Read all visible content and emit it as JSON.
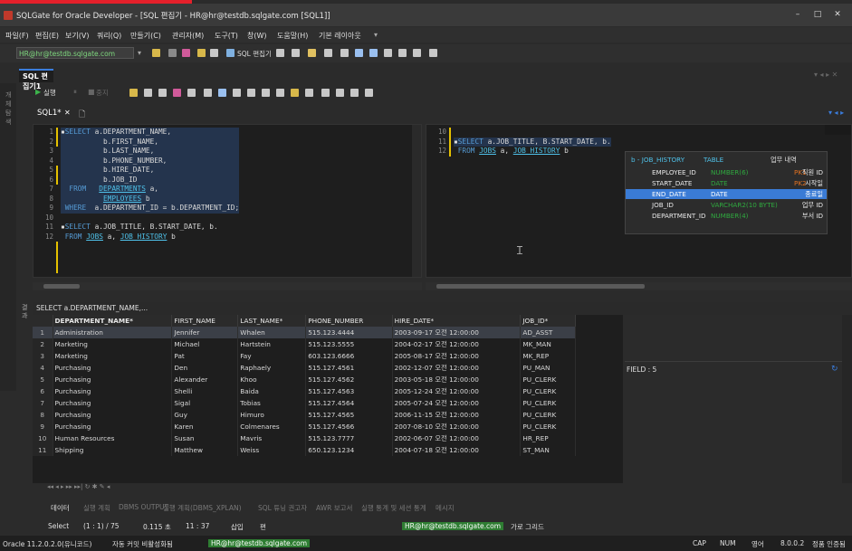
{
  "window": {
    "title": "SQLGate for Oracle Developer - [SQL 편집기 - HR@hr@testdb.sqlgate.com [SQL1]]"
  },
  "menu": [
    "파일(F)",
    "편집(E)",
    "보기(V)",
    "쿼리(Q)",
    "만들기(C)",
    "관리자(M)",
    "도구(T)",
    "창(W)",
    "도움말(H)",
    "기본 레이아웃"
  ],
  "toolbar": {
    "connection": "HR@hr@testdb.sqlgate.com",
    "sql_editor_label": "SQL 편집기"
  },
  "doc_tab": "SQL 편집기1",
  "editor_toolbar": {
    "run": "실행",
    "stop": "중지"
  },
  "sql_tab": "SQL1*",
  "sidebar_label": "개체 탐색",
  "editor_left": {
    "line_numbers": [
      "1",
      "2",
      "3",
      "4",
      "5",
      "6",
      "7",
      "8",
      "9",
      "10",
      "11",
      "12"
    ],
    "lines": [
      [
        "kw:SELECT",
        " a.DEPARTMENT_NAME,"
      ],
      [
        "",
        "          b.FIRST_NAME,"
      ],
      [
        "",
        "          b.LAST_NAME,"
      ],
      [
        "",
        "          b.PHONE_NUMBER,"
      ],
      [
        "",
        "          b.HIRE_DATE,"
      ],
      [
        "",
        "          b.JOB_ID"
      ],
      [
        "kw:  FROM",
        "   ",
        "tbl:DEPARTMENTS",
        " a,"
      ],
      [
        "",
        "          ",
        "tbl:EMPLOYEES",
        " b"
      ],
      [
        "kw: WHERE",
        "  a.DEPARTMENT_ID = b.DEPARTMENT_ID;"
      ],
      [
        ""
      ],
      [
        "kw:SELECT",
        " a.JOB_TITLE, B.START_DATE, b."
      ],
      [
        "kw: FROM",
        " ",
        "tbl:JOBS",
        " a, ",
        "tbl:JOB_HISTORY",
        " b"
      ]
    ]
  },
  "editor_right": {
    "line_numbers": [
      "10",
      "11",
      "12"
    ],
    "lines": [
      [
        ""
      ],
      [
        "kw:SELECT",
        " a.JOB_TITLE, B.START_DATE, b."
      ],
      [
        "kw: FROM",
        " ",
        "tbl:JOBS",
        " a, ",
        "tbl:JOB_HISTORY",
        " b"
      ]
    ]
  },
  "autocomplete": {
    "header": {
      "name": "b - JOB_HISTORY",
      "type": "TABLE",
      "comment": "업무 내역"
    },
    "rows": [
      {
        "name": "EMPLOYEE_ID",
        "type": "NUMBER(6)",
        "key": "PK1",
        "comment": "직원 ID",
        "selected": false
      },
      {
        "name": "START_DATE",
        "type": "DATE",
        "key": "PK2",
        "comment": "시작일",
        "selected": false
      },
      {
        "name": "END_DATE",
        "type": "DATE",
        "key": "",
        "comment": "종료일",
        "selected": true
      },
      {
        "name": "JOB_ID",
        "type": "VARCHAR2(10 BYTE)",
        "key": "",
        "comment": "업무 ID",
        "selected": false
      },
      {
        "name": "DEPARTMENT_ID",
        "type": "NUMBER(4)",
        "key": "",
        "comment": "부서 ID",
        "selected": false
      }
    ]
  },
  "field_count": "FIELD : 5",
  "results": {
    "side_label": "결과",
    "query_label": "SELECT a.DEPARTMENT_NAME,...",
    "columns": [
      "DEPARTMENT_NAME*",
      "FIRST_NAME",
      "LAST_NAME*",
      "PHONE_NUMBER",
      "HIRE_DATE*",
      "JOB_ID*"
    ],
    "rows": [
      [
        "1",
        "Administration",
        "Jennifer",
        "Whalen",
        "515.123.4444",
        "2003-09-17 오전 12:00:00",
        "AD_ASST"
      ],
      [
        "2",
        "Marketing",
        "Michael",
        "Hartstein",
        "515.123.5555",
        "2004-02-17 오전 12:00:00",
        "MK_MAN"
      ],
      [
        "3",
        "Marketing",
        "Pat",
        "Fay",
        "603.123.6666",
        "2005-08-17 오전 12:00:00",
        "MK_REP"
      ],
      [
        "4",
        "Purchasing",
        "Den",
        "Raphaely",
        "515.127.4561",
        "2002-12-07 오전 12:00:00",
        "PU_MAN"
      ],
      [
        "5",
        "Purchasing",
        "Alexander",
        "Khoo",
        "515.127.4562",
        "2003-05-18 오전 12:00:00",
        "PU_CLERK"
      ],
      [
        "6",
        "Purchasing",
        "Shelli",
        "Baida",
        "515.127.4563",
        "2005-12-24 오전 12:00:00",
        "PU_CLERK"
      ],
      [
        "7",
        "Purchasing",
        "Sigal",
        "Tobias",
        "515.127.4564",
        "2005-07-24 오전 12:00:00",
        "PU_CLERK"
      ],
      [
        "8",
        "Purchasing",
        "Guy",
        "Himuro",
        "515.127.4565",
        "2006-11-15 오전 12:00:00",
        "PU_CLERK"
      ],
      [
        "9",
        "Purchasing",
        "Karen",
        "Colmenares",
        "515.127.4566",
        "2007-08-10 오전 12:00:00",
        "PU_CLERK"
      ],
      [
        "10",
        "Human Resources",
        "Susan",
        "Mavris",
        "515.123.7777",
        "2002-06-07 오전 12:00:00",
        "HR_REP"
      ],
      [
        "11",
        "Shipping",
        "Matthew",
        "Weiss",
        "650.123.1234",
        "2004-07-18 오전 12:00:00",
        "ST_MAN"
      ]
    ]
  },
  "bottom_tabs": [
    "데이터",
    "실행 계획",
    "DBMS OUTPUT",
    "실행 계획(DBMS_XPLAN)",
    "SQL 튜닝 권고자",
    "AWR 보고서",
    "실행 통계 및 세션 통계",
    "메시지"
  ],
  "status": {
    "mode": "Select",
    "position": "(1 : 1) / 75",
    "time": "0.115 초",
    "clock": "11 : 37",
    "insert": "삽입",
    "edit": "편",
    "connection": "HR@hr@testdb.sqlgate.com",
    "grid_mode": "가로 그리드"
  },
  "bottom_bar": {
    "client": "Oracle 11.2.0.2.0(유니코드)",
    "commit": "자동 커밋 비활성화됨",
    "connection": "HR@hr@testdb.sqlgate.com",
    "caps": "CAP",
    "num": "NUM",
    "lang": "영어",
    "version": "8.0.0.2",
    "license": "정품 인증됨"
  },
  "colors": {
    "keyword": "#569cd6",
    "table": "#4fc1e9",
    "accent": "#3b7ddd",
    "highlight": "#3a7bd5",
    "pk": "#e07020",
    "number_type": "#2faa3f"
  }
}
